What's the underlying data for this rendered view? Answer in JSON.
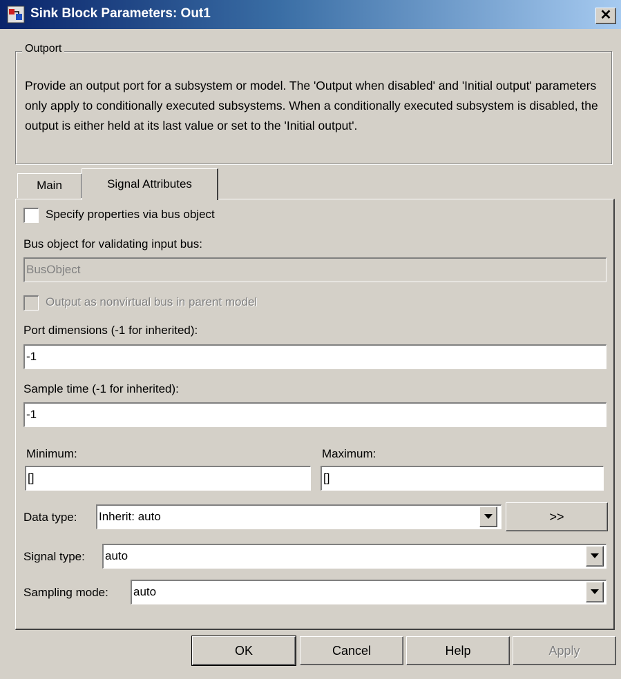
{
  "window": {
    "title": "Sink Block Parameters: Out1",
    "close_glyph": "✕"
  },
  "group": {
    "legend": "Outport",
    "description": "Provide an output port for a subsystem or model.  The 'Output when disabled' and 'Initial output' parameters only apply to conditionally executed subsystems. When a conditionally executed subsystem is disabled, the output is either held at its last value or set to the 'Initial output'."
  },
  "tabs": [
    {
      "label": "Main",
      "active": false
    },
    {
      "label": "Signal Attributes",
      "active": true
    }
  ],
  "form": {
    "bus_checkbox_label": "Specify properties via bus object",
    "bus_checkbox_checked": false,
    "bus_object_label": "Bus object for validating input bus:",
    "bus_object_value": "BusObject",
    "nonvirtual_label": "Output as nonvirtual bus in parent model",
    "nonvirtual_checked": false,
    "port_dim_label": "Port dimensions (-1 for inherited):",
    "port_dim_value": "-1",
    "sample_time_label": "Sample time (-1 for inherited):",
    "sample_time_value": "-1",
    "minimum_label": "Minimum:",
    "minimum_value": "[]",
    "maximum_label": "Maximum:",
    "maximum_value": "[]",
    "data_type_label": "Data type:",
    "data_type_value": "Inherit: auto",
    "assistant_button": ">>",
    "signal_type_label": "Signal type:",
    "signal_type_value": "auto",
    "sampling_mode_label": "Sampling mode:",
    "sampling_mode_value": "auto"
  },
  "buttons": {
    "ok": "OK",
    "cancel": "Cancel",
    "help": "Help",
    "apply": "Apply"
  },
  "colors": {
    "titlebar_start": "#0a246a",
    "titlebar_end": "#a6caf0",
    "face": "#d4d0c8"
  },
  "icons": [
    "simulink-app-icon",
    "close-icon",
    "dropdown-arrow-icon"
  ]
}
